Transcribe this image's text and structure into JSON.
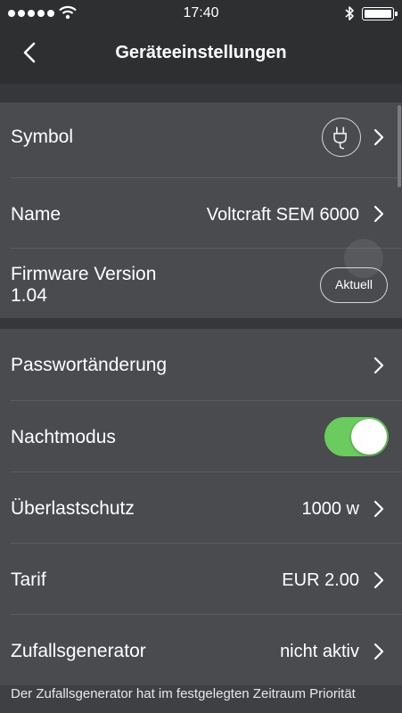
{
  "status_bar": {
    "time": "17:40"
  },
  "nav": {
    "title": "Geräteeinstellungen"
  },
  "rows": {
    "symbol": {
      "label": "Symbol"
    },
    "name": {
      "label": "Name",
      "value": "Voltcraft SEM 6000"
    },
    "firmware": {
      "label_line1": "Firmware Version",
      "label_line2": "1.04",
      "button": "Aktuell"
    },
    "password": {
      "label": "Passwortänderung"
    },
    "night_mode": {
      "label": "Nachtmodus",
      "enabled": true
    },
    "overload": {
      "label": "Überlastschutz",
      "value": "1000 w"
    },
    "tariff": {
      "label": "Tarif",
      "value": "EUR 2.00"
    },
    "random": {
      "label": "Zufallsgenerator",
      "value": "nicht aktiv"
    }
  },
  "footnote": "Der Zufallsgenerator hat im festgelegten Zeitraum Priorität",
  "colors": {
    "background": "#3f4043",
    "row_background": "#4a4b4f",
    "nav_background": "#2e2f31",
    "toggle_on": "#6ccb5f"
  },
  "icons": [
    "signal-dots-icon",
    "wifi-icon",
    "bluetooth-icon",
    "battery-icon",
    "back-chevron-icon",
    "plug-icon",
    "chevron-right-icon"
  ]
}
